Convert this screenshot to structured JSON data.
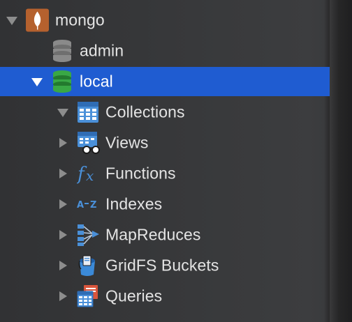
{
  "tree": {
    "root": {
      "label": "mongo",
      "icon": "mongodb-leaf-icon",
      "expanded": true
    },
    "databases": [
      {
        "label": "admin",
        "icon": "database-icon",
        "expanded": false,
        "color": "#8a8a8a"
      },
      {
        "label": "local",
        "icon": "database-icon",
        "expanded": true,
        "selected": true,
        "color": "#2f9d3a"
      }
    ],
    "local_children": [
      {
        "label": "Collections",
        "icon": "table-grid-icon",
        "expanded": true
      },
      {
        "label": "Views",
        "icon": "view-glasses-icon",
        "expanded": false
      },
      {
        "label": "Functions",
        "icon": "function-fx-icon",
        "expanded": false
      },
      {
        "label": "Indexes",
        "icon": "a-z-index-icon",
        "expanded": false
      },
      {
        "label": "MapReduces",
        "icon": "mapreduce-icon",
        "expanded": false
      },
      {
        "label": "GridFS Buckets",
        "icon": "bucket-icon",
        "expanded": false
      },
      {
        "label": "Queries",
        "icon": "queries-icon",
        "expanded": false
      }
    ]
  },
  "colors": {
    "selection": "#1f5cd1",
    "text": "#e4e4e4",
    "accent_blue": "#4a90d9",
    "mongo_brown": "#b5612e"
  }
}
